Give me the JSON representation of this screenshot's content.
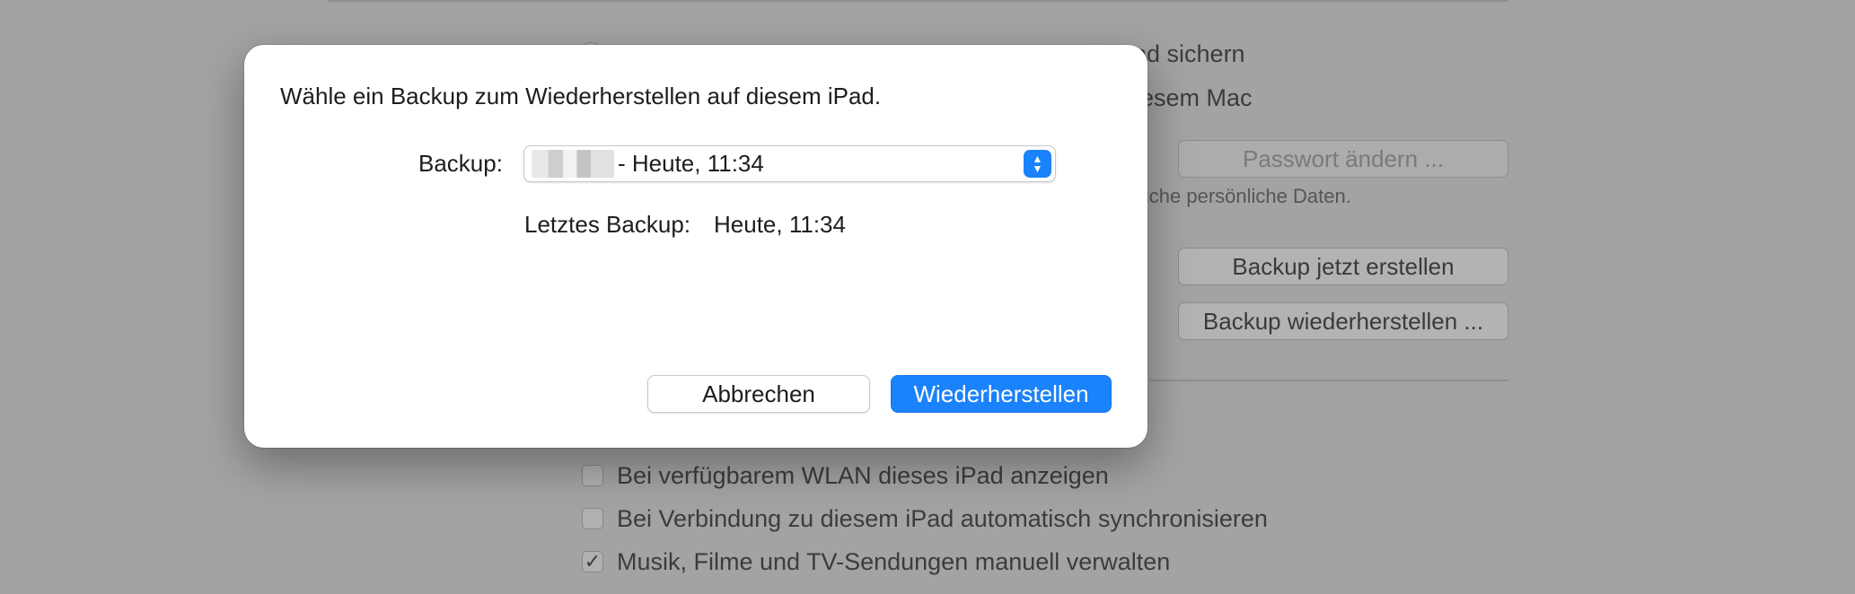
{
  "background": {
    "top_right_text_1": "nd sichern",
    "top_right_text_2": "esem Mac",
    "change_password_button": "Passwort ändern ...",
    "personal_data_note": "liche persönliche Daten.",
    "backup_now_button": "Backup jetzt erstellen",
    "restore_backup_button": "Backup wiederherstellen ...",
    "options": [
      {
        "label": "Bei verfügbarem WLAN dieses iPad anzeigen",
        "checked": false
      },
      {
        "label": "Bei Verbindung zu diesem iPad automatisch synchronisieren",
        "checked": false
      },
      {
        "label": "Musik, Filme und TV-Sendungen manuell verwalten",
        "checked": true
      }
    ]
  },
  "dialog": {
    "title": "Wähle ein Backup zum Wiederherstellen auf diesem iPad.",
    "backup_label": "Backup:",
    "backup_selected": "- Heute, 11:34",
    "last_backup_label": "Letztes Backup:",
    "last_backup_value": "Heute, 11:34",
    "cancel_button": "Abbrechen",
    "restore_button": "Wiederherstellen"
  },
  "colors": {
    "accent": "#1a82fb"
  }
}
